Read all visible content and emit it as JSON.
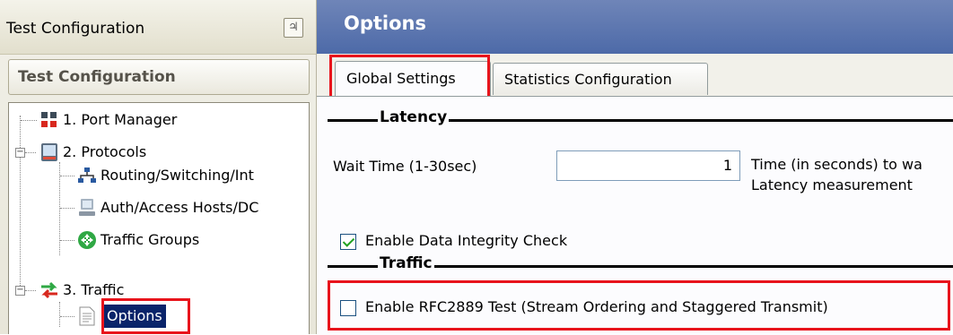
{
  "left_panel": {
    "title": "Test Configuration",
    "pin_glyph": "♃",
    "header": "Test Configuration",
    "tree": [
      {
        "label": "1. Port Manager",
        "icon": "port-manager-icon"
      },
      {
        "label": "2. Protocols",
        "icon": "protocols-icon",
        "expanded": true
      },
      {
        "label": "Routing/Switching/Int",
        "icon": "network-icon"
      },
      {
        "label": "Auth/Access Hosts/DC",
        "icon": "host-icon"
      },
      {
        "label": "Traffic Groups",
        "icon": "traffic-groups-icon"
      },
      {
        "label": "3. Traffic",
        "icon": "traffic-icon",
        "expanded": true
      },
      {
        "label": "Options",
        "icon": "document-icon",
        "selected": true
      }
    ],
    "expander_minus": "−"
  },
  "options_panel": {
    "title": "Options",
    "tabs": [
      {
        "label": "Global Settings",
        "active": true
      },
      {
        "label": "Statistics Configuration",
        "active": false
      }
    ],
    "latency": {
      "title": "Latency",
      "wait_time_label": "Wait Time (1-30sec)",
      "wait_time_value": "1",
      "description_line1": "Time (in seconds) to wa",
      "description_line2": "Latency measurement",
      "data_integrity_label": "Enable Data Integrity Check",
      "data_integrity_checked": true
    },
    "traffic": {
      "title": "Traffic",
      "rfc_label": "Enable RFC2889 Test (Stream Ordering and Staggered Transmit)",
      "rfc_checked": false
    }
  },
  "colors": {
    "highlight": "#e8141c",
    "title_blue": "#4d6aa8",
    "selection": "#0a246a"
  }
}
